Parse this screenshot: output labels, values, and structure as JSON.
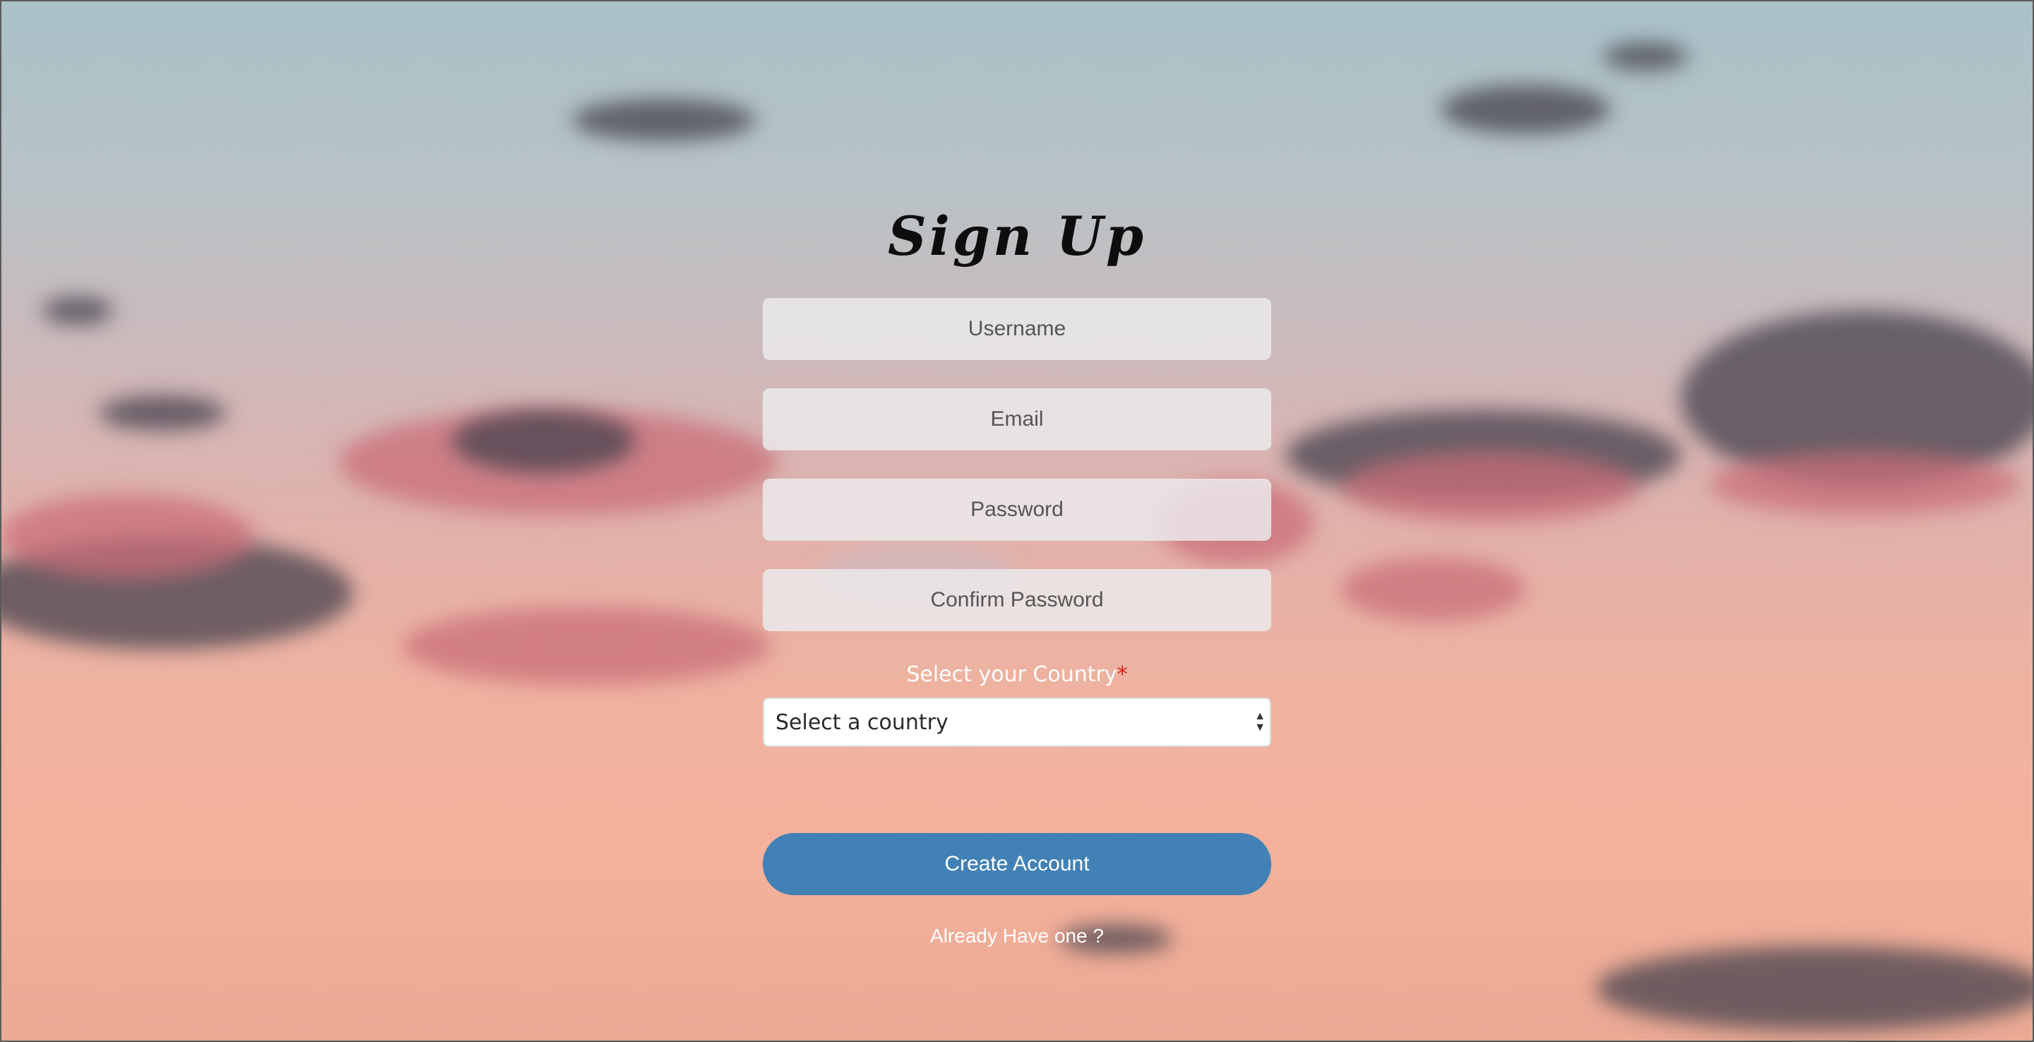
{
  "signup": {
    "title": "Sign Up",
    "username_placeholder": "Username",
    "email_placeholder": "Email",
    "password_placeholder": "Password",
    "confirm_password_placeholder": "Confirm Password",
    "country_label": "Select your Country",
    "required_marker": "*",
    "country_select_value": "Select a country",
    "submit_label": "Create Account",
    "login_link": "Already Have one ?"
  },
  "colors": {
    "button": "#4281b5",
    "required": "#e01b1b",
    "field_background": "#ececee"
  },
  "icons": {
    "select_arrows": "up-down-chevron-icon"
  }
}
